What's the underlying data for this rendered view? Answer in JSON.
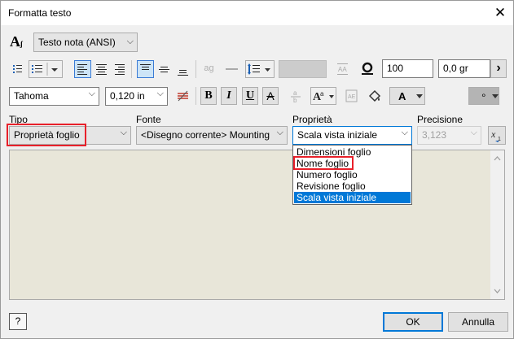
{
  "window": {
    "title": "Formatta testo",
    "close_glyph": "✕"
  },
  "style_combo": {
    "value": "Testo nota (ANSI)"
  },
  "toolbar1": {
    "spacing_value": "100",
    "rotation_value": "0,0 gr",
    "ag_glyph": "ag",
    "next_glyph": "›"
  },
  "toolbar2": {
    "font_value": "Tahoma",
    "size_value": "0,120 in",
    "bold": "B",
    "italic": "I",
    "underline": "U",
    "strike": "A",
    "color_label": "A",
    "fill_label": "∘"
  },
  "labels": {
    "tipo": "Tipo",
    "fonte": "Fonte",
    "proprieta": "Proprietà",
    "precisione": "Precisione"
  },
  "tipo_combo": {
    "value": "Proprietà foglio"
  },
  "fonte_combo": {
    "value": "<Disegno corrente> Mounting"
  },
  "proprieta_combo": {
    "value": "Scala vista iniziale"
  },
  "precisione_combo": {
    "value": "3,123"
  },
  "dropdown": {
    "items": [
      "Dimensioni foglio",
      "Nome foglio",
      "Numero foglio",
      "Revisione foglio",
      "Scala vista iniziale"
    ],
    "selected_index": 4,
    "highlighted_index": 1
  },
  "footer": {
    "help_glyph": "?",
    "ok_label": "OK",
    "cancel_label": "Annulla"
  },
  "colors": {
    "accent": "#0078d7",
    "highlight_red": "#e8202a",
    "editor_bg": "#e8e6d9"
  }
}
